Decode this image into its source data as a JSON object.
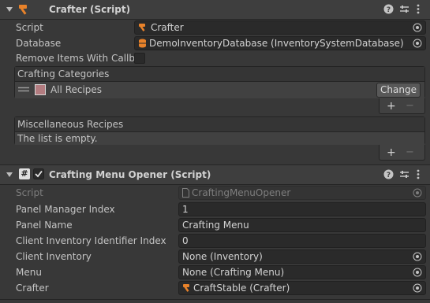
{
  "crafter": {
    "title": "Crafter (Script)",
    "script_label": "Script",
    "script_value": "Crafter",
    "database_label": "Database",
    "database_value": "DemoInventoryDatabase (InventorySystemDatabase)",
    "remove_items_label": "Remove Items With Callbac",
    "crafting_categories": {
      "header": "Crafting Categories",
      "item_label": "All Recipes",
      "item_color": "#b37c80",
      "change_button": "Change",
      "add": "+",
      "remove": "−"
    },
    "misc_recipes": {
      "header": "Miscellaneous Recipes",
      "empty_text": "The list is empty.",
      "add": "+",
      "remove": "−"
    }
  },
  "opener": {
    "title": "Crafting Menu Opener (Script)",
    "enabled": true,
    "fields": [
      {
        "label": "Script",
        "value": "CraftingMenuOpener"
      },
      {
        "label": "Panel Manager Index",
        "value": "1"
      },
      {
        "label": "Panel Name",
        "value": "Crafting Menu"
      },
      {
        "label": "Client Inventory Identifier Index",
        "value": "0"
      },
      {
        "label": "Client Inventory",
        "value": "None (Inventory)"
      },
      {
        "label": "Menu",
        "value": "None (Crafting Menu)"
      },
      {
        "label": "Crafter",
        "value": "CraftStable (Crafter)"
      }
    ]
  },
  "header_icons": [
    "help-icon",
    "presets-icon",
    "kebab-menu-icon"
  ],
  "colors": {
    "background": "#383838",
    "field": "#2a2a2a",
    "header": "#3e3e3e",
    "accent_orange": "#e8822a"
  }
}
